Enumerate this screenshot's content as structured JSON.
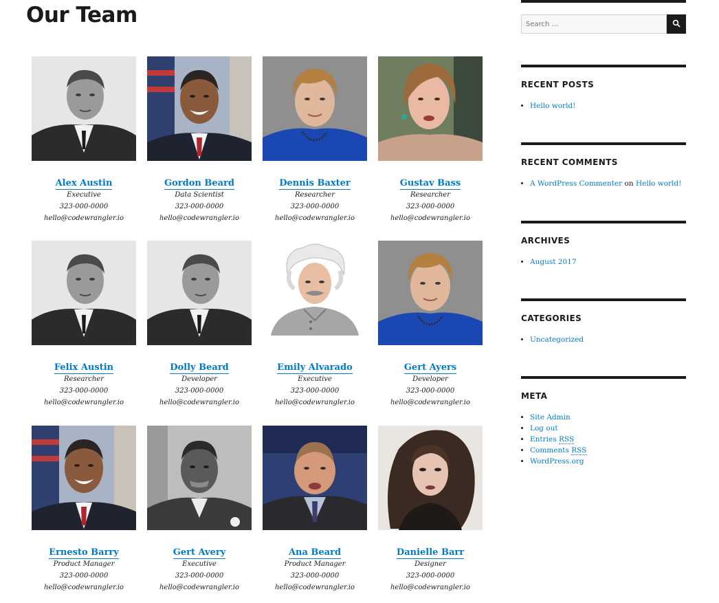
{
  "page": {
    "title": "Our Team"
  },
  "team": [
    {
      "name": "Alex Austin",
      "role": "Executive",
      "phone": "323-000-0000",
      "email": "hello@codewrangler.io",
      "photo": "roosevelt"
    },
    {
      "name": "Gordon Beard",
      "role": "Data Scientist",
      "phone": "323-000-0000",
      "email": "hello@codewrangler.io",
      "photo": "obama"
    },
    {
      "name": "Dennis Baxter",
      "role": "Researcher",
      "phone": "323-000-0000",
      "email": "hello@codewrangler.io",
      "photo": "merkel"
    },
    {
      "name": "Gustav Bass",
      "role": "Researcher",
      "phone": "323-000-0000",
      "email": "hello@codewrangler.io",
      "photo": "hillary"
    },
    {
      "name": "Felix Austin",
      "role": "Researcher",
      "phone": "323-000-0000",
      "email": "hello@codewrangler.io",
      "photo": "roosevelt"
    },
    {
      "name": "Dolly Beard",
      "role": "Developer",
      "phone": "323-000-0000",
      "email": "hello@codewrangler.io",
      "photo": "roosevelt"
    },
    {
      "name": "Emily Alvarado",
      "role": "Executive",
      "phone": "323-000-0000",
      "email": "hello@codewrangler.io",
      "photo": "einstein"
    },
    {
      "name": "Gert Ayers",
      "role": "Developer",
      "phone": "323-000-0000",
      "email": "hello@codewrangler.io",
      "photo": "merkel"
    },
    {
      "name": "Ernesto Barry",
      "role": "Product Manager",
      "phone": "323-000-0000",
      "email": "hello@codewrangler.io",
      "photo": "obama"
    },
    {
      "name": "Gert Avery",
      "role": "Executive",
      "phone": "323-000-0000",
      "email": "hello@codewrangler.io",
      "photo": "carver"
    },
    {
      "name": "Ana Beard",
      "role": "Product Manager",
      "phone": "323-000-0000",
      "email": "hello@codewrangler.io",
      "photo": "spicer"
    },
    {
      "name": "Danielle Barr",
      "role": "Designer",
      "phone": "323-000-0000",
      "email": "hello@codewrangler.io",
      "photo": "bonham"
    }
  ],
  "sidebar": {
    "search": {
      "placeholder": "Search …"
    },
    "recent_posts": {
      "title": "RECENT POSTS",
      "items": [
        "Hello world!"
      ]
    },
    "recent_comments": {
      "title": "RECENT COMMENTS",
      "author": "A WordPress Commenter",
      "on": "on",
      "post": "Hello world!"
    },
    "archives": {
      "title": "ARCHIVES",
      "items": [
        "August 2017"
      ]
    },
    "categories": {
      "title": "CATEGORIES",
      "items": [
        "Uncategorized"
      ]
    },
    "meta": {
      "title": "META",
      "items": {
        "site_admin": "Site Admin",
        "log_out": "Log out",
        "entries_prefix": "Entries",
        "entries_abbr": "RSS",
        "comments_prefix": "Comments",
        "comments_abbr": "RSS",
        "wordpress_org": "WordPress.org"
      }
    }
  },
  "colors": {
    "link": "#007acc",
    "text": "#1a1a1a",
    "rule": "#1a1a1a"
  }
}
